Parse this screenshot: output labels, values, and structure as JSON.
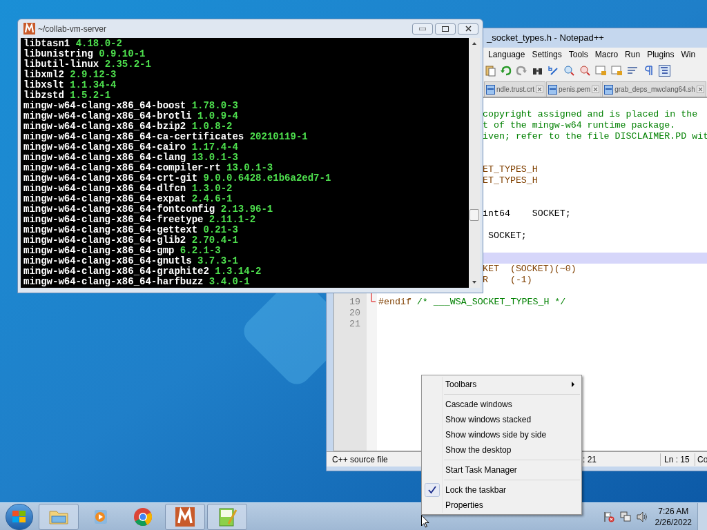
{
  "terminal": {
    "title": "~/collab-vm-server",
    "lines": [
      {
        "name": "libtasn1",
        "version": "4.18.0-2"
      },
      {
        "name": "libunistring",
        "version": "0.9.10-1"
      },
      {
        "name": "libutil-linux",
        "version": "2.35.2-1"
      },
      {
        "name": "libxml2",
        "version": "2.9.12-3"
      },
      {
        "name": "libxslt",
        "version": "1.1.34-4"
      },
      {
        "name": "libzstd",
        "version": "1.5.2-1"
      },
      {
        "name": "mingw-w64-clang-x86_64-boost",
        "version": "1.78.0-3"
      },
      {
        "name": "mingw-w64-clang-x86_64-brotli",
        "version": "1.0.9-4"
      },
      {
        "name": "mingw-w64-clang-x86_64-bzip2",
        "version": "1.0.8-2"
      },
      {
        "name": "mingw-w64-clang-x86_64-ca-certificates",
        "version": "20210119-1"
      },
      {
        "name": "mingw-w64-clang-x86_64-cairo",
        "version": "1.17.4-4"
      },
      {
        "name": "mingw-w64-clang-x86_64-clang",
        "version": "13.0.1-3"
      },
      {
        "name": "mingw-w64-clang-x86_64-compiler-rt",
        "version": "13.0.1-3"
      },
      {
        "name": "mingw-w64-clang-x86_64-crt-git",
        "version": "9.0.0.6428.e1b6a2ed7-1"
      },
      {
        "name": "mingw-w64-clang-x86_64-dlfcn",
        "version": "1.3.0-2"
      },
      {
        "name": "mingw-w64-clang-x86_64-expat",
        "version": "2.4.6-1"
      },
      {
        "name": "mingw-w64-clang-x86_64-fontconfig",
        "version": "2.13.96-1"
      },
      {
        "name": "mingw-w64-clang-x86_64-freetype",
        "version": "2.11.1-2"
      },
      {
        "name": "mingw-w64-clang-x86_64-gettext",
        "version": "0.21-3"
      },
      {
        "name": "mingw-w64-clang-x86_64-glib2",
        "version": "2.70.4-1"
      },
      {
        "name": "mingw-w64-clang-x86_64-gmp",
        "version": "6.2.1-3"
      },
      {
        "name": "mingw-w64-clang-x86_64-gnutls",
        "version": "3.7.3-1"
      },
      {
        "name": "mingw-w64-clang-x86_64-graphite2",
        "version": "1.3.14-2"
      },
      {
        "name": "mingw-w64-clang-x86_64-harfbuzz",
        "version": "3.4.0-1"
      }
    ]
  },
  "notepad": {
    "title": "_socket_types.h - Notepad++",
    "menu": [
      "Language",
      "Settings",
      "Tools",
      "Macro",
      "Run",
      "Plugins",
      "Win"
    ],
    "tabs": [
      {
        "label": "ndle.trust.crt",
        "selected": false
      },
      {
        "label": "penis.pem",
        "selected": false
      },
      {
        "label": "grab_deps_mwclang64.sh",
        "selected": false
      }
    ],
    "lines": [
      {
        "kind": "clipped",
        "current": false
      },
      {
        "kind": "clipped",
        "current": false,
        "segments": [
          {
            "text": "copyright assigned and is placed in the",
            "kind": "comment"
          }
        ]
      },
      {
        "kind": "clipped",
        "current": false,
        "segments": [
          {
            "text": "t of the mingw-w64 runtime package.",
            "kind": "comment"
          }
        ]
      },
      {
        "kind": "clipped",
        "current": false,
        "segments": [
          {
            "text": "iven; refer to the file DISCLAIMER.PD wit",
            "kind": "comment"
          }
        ]
      },
      {
        "kind": "clipped",
        "current": false
      },
      {
        "kind": "clipped",
        "current": false
      },
      {
        "kind": "clipped",
        "current": false,
        "segments": [
          {
            "text": "ET_TYPES_H",
            "kind": "preprocessor"
          }
        ]
      },
      {
        "kind": "clipped",
        "current": false,
        "segments": [
          {
            "text": "ET_TYPES_H",
            "kind": "preprocessor"
          }
        ]
      },
      {
        "kind": "clipped",
        "current": false
      },
      {
        "kind": "clipped",
        "current": false
      },
      {
        "kind": "clipped",
        "current": false,
        "segments": [
          {
            "text": "int64    SOCKET;",
            "kind": "plain"
          }
        ]
      },
      {
        "kind": "clipped",
        "current": false
      },
      {
        "kind": "clipped",
        "current": false,
        "segments": [
          {
            "text": " SOCKET;",
            "kind": "plain"
          }
        ]
      },
      {
        "kind": "clipped",
        "current": false
      },
      {
        "kind": "clipped",
        "current": true
      },
      {
        "kind": "clipped",
        "current": false,
        "segments": [
          {
            "text": "KET  (SOCKET)(~0)",
            "kind": "preprocessor"
          }
        ]
      },
      {
        "kind": "clipped",
        "current": false,
        "segments": [
          {
            "text": "R    (-1)",
            "kind": "preprocessor"
          }
        ]
      },
      {
        "kind": "clipped",
        "current": false
      },
      {
        "kind": "numbered",
        "current": false,
        "number": "19",
        "fold_end": true,
        "segments": [
          {
            "text": "#endif ",
            "kind": "preprocessor"
          },
          {
            "text": "/* ___WSA_SOCKET_TYPES_H */",
            "kind": "comment"
          }
        ]
      },
      {
        "kind": "numbered",
        "current": false,
        "number": "20"
      },
      {
        "kind": "numbered",
        "current": false,
        "number": "21"
      }
    ],
    "status": [
      {
        "kind": "type",
        "text": "C++ source file"
      },
      {
        "kind": "length",
        "text": ": 21"
      },
      {
        "kind": "line",
        "text": "Ln : 15"
      },
      {
        "kind": "col",
        "text": "Co"
      }
    ]
  },
  "context_menu": {
    "items": [
      {
        "kind": "submenu",
        "label": "Toolbars",
        "checked": false
      },
      {
        "kind": "separator"
      },
      {
        "kind": "item",
        "label": "Cascade windows",
        "checked": false
      },
      {
        "kind": "item",
        "label": "Show windows stacked",
        "checked": false
      },
      {
        "kind": "item",
        "label": "Show windows side by side",
        "checked": false
      },
      {
        "kind": "item",
        "label": "Show the desktop",
        "checked": false
      },
      {
        "kind": "separator"
      },
      {
        "kind": "item",
        "label": "Start Task Manager",
        "checked": false
      },
      {
        "kind": "separator"
      },
      {
        "kind": "item",
        "label": "Lock the taskbar",
        "checked": true
      },
      {
        "kind": "item",
        "label": "Properties",
        "checked": false
      }
    ]
  },
  "taskbar": {
    "apps": [
      {
        "kind": "folder",
        "running": true
      },
      {
        "kind": "media",
        "running": false
      },
      {
        "kind": "browser",
        "running": false
      },
      {
        "kind": "terminal",
        "running": true
      },
      {
        "kind": "editor",
        "running": true
      }
    ],
    "clock": {
      "time": "7:26 AM",
      "date": "2/26/2022"
    }
  }
}
